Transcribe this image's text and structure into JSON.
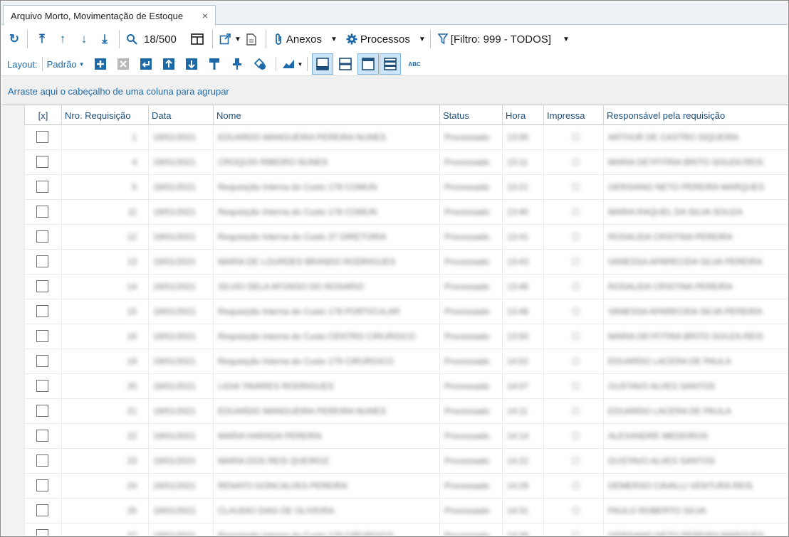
{
  "tab": {
    "title": "Arquivo Morto, Movimentação de Estoque",
    "close": "×"
  },
  "toolbar1": {
    "refresh_icon": "↻",
    "first_icon": "⤒",
    "up_icon": "↑",
    "down_icon": "↓",
    "last_icon": "⤓",
    "search_icon": "🔍",
    "record_counter": "18/500",
    "anexos_label": "Anexos",
    "processos_label": "Processos",
    "filter_label": "[Filtro: 999 - TODOS]"
  },
  "toolbar2": {
    "layout_label": "Layout:",
    "padrao_label": "Padrão",
    "abc_label": "ABC"
  },
  "group_panel": {
    "text": "Arraste aqui o cabeçalho de uma coluna para agrupar"
  },
  "columns": [
    "[x]",
    "Nro. Requisição",
    "Data",
    "Nome",
    "Status",
    "Hora",
    "Impressa",
    "Responsável pela requisição"
  ],
  "rows": [
    [
      "1",
      "19/01/2021",
      "EDUARDO MANGUEIRA PEREIRA NUNES",
      "Processado",
      "13:00",
      "☐",
      "ARTHUR DE CASTRO SIQUEIRA"
    ],
    [
      "4",
      "19/01/2021",
      "CROQUIS RIBEIRO NUNES",
      "Processado",
      "13:11",
      "☐",
      "MARIA DEYFITRIA BRITO SOUZA REIS"
    ],
    [
      "5",
      "19/01/2021",
      "Requisição Interna do Custo 178 COMUN",
      "Processado",
      "13:21",
      "☐",
      "GERSIANO NETO PEREIRA MARQUES"
    ],
    [
      "11",
      "19/01/2021",
      "Requisição Interna do Custo 178 COMUN",
      "Processado",
      "13:40",
      "☐",
      "MARIA RAQUEL DA SILVA SOUZA"
    ],
    [
      "12",
      "19/01/2021",
      "Requisição Interna do Custo 37 DIRETORIA",
      "Processado",
      "13:41",
      "☐",
      "ROSALIDA CRISTINA PEREIRA"
    ],
    [
      "13",
      "19/01/2021",
      "MARIA DE LOURDES BRANDO RODRIGUES",
      "Processado",
      "13:43",
      "☐",
      "VANESSA APARECIDA SILVA PEREIRA"
    ],
    [
      "14",
      "19/01/2021",
      "SILVIO DELA AFONSO DO ROSARIO",
      "Processado",
      "13:46",
      "☐",
      "ROSALIDA CRISTINA PEREIRA"
    ],
    [
      "15",
      "19/01/2021",
      "Requisição Interna do Custo 178 PORTICULAR",
      "Processado",
      "13:46",
      "☐",
      "VANESSA APARECIDA SILVA PEREIRA"
    ],
    [
      "16",
      "19/01/2021",
      "Requisição Interna do Custo CENTRO CIRURGICO",
      "Processado",
      "13:50",
      "☐",
      "MARIA DEYFITRIA BRITO SOUZA REIS"
    ],
    [
      "19",
      "19/01/2021",
      "Requisição Interna do Custo 179 CIRURGICO",
      "Processado",
      "14:02",
      "☐",
      "EDUARDO LACERA DE PAULA"
    ],
    [
      "20",
      "19/01/2021",
      "LIGIA TAVARES RODRIGUES",
      "Processado",
      "14:07",
      "☐",
      "GUSTAVO ALVES SANTOS"
    ],
    [
      "21",
      "19/01/2021",
      "EDUARDO MANGUEIRA PEREIRA NUNES",
      "Processado",
      "14:11",
      "☐",
      "EDUARDO LACERA DE PAULA"
    ],
    [
      "22",
      "19/01/2021",
      "MARIA HARADA PEREIRA",
      "Processado",
      "14:14",
      "☐",
      "ALEXANDRE MEDEIROS"
    ],
    [
      "23",
      "19/01/2021",
      "MARIA DOS REIS QUEIROZ",
      "Processado",
      "14:22",
      "☐",
      "GUSTAVO ALVES SANTOS"
    ],
    [
      "24",
      "19/01/2021",
      "RENATO GONCALVES PEREIRA",
      "Processado",
      "14:29",
      "☐",
      "DEMERSO CAVALLI VENTURA REIS"
    ],
    [
      "25",
      "19/01/2021",
      "CLAUDIO DIAS DE OLIVEIRA",
      "Processado",
      "14:31",
      "☐",
      "PAULO ROBERTO SILVA"
    ],
    [
      "27",
      "19/01/2021",
      "Requisição Interna do Custo 179 CIRURGICO",
      "Processado",
      "14:39",
      "☐",
      "GERSIANO NETO PEREIRA MARQUES"
    ]
  ]
}
